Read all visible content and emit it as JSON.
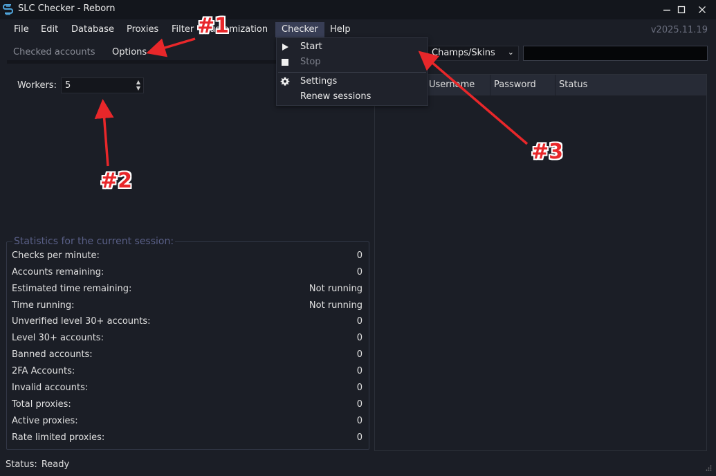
{
  "window": {
    "title": "SLC Checker - Reborn",
    "controls": {
      "minimize": "—",
      "maximize": "☐",
      "close": "✕"
    }
  },
  "menubar": {
    "items": [
      "File",
      "Edit",
      "Database",
      "Proxies",
      "Filter",
      "Customization",
      "Checker",
      "Help"
    ],
    "active": "Checker",
    "version": "v2025.11.19"
  },
  "tabs": {
    "checked_accounts": "Checked accounts",
    "options": "Options"
  },
  "workers": {
    "label": "Workers:",
    "value": "5"
  },
  "stats": {
    "title": "Statistics for the current session:",
    "rows": [
      {
        "label": "Checks per minute:",
        "value": "0"
      },
      {
        "label": "Accounts remaining:",
        "value": "0"
      },
      {
        "label": "Estimated time remaining:",
        "value": "Not running"
      },
      {
        "label": "Time running:",
        "value": "Not running"
      },
      {
        "label": "Unverified level 30+ accounts:",
        "value": "0"
      },
      {
        "label": "Level 30+ accounts:",
        "value": "0"
      },
      {
        "label": "Banned accounts:",
        "value": "0"
      },
      {
        "label": "2FA Accounts:",
        "value": "0"
      },
      {
        "label": "Invalid accounts:",
        "value": "0"
      },
      {
        "label": "Total proxies:",
        "value": "0"
      },
      {
        "label": "Active proxies:",
        "value": "0"
      },
      {
        "label": "Rate limited proxies:",
        "value": "0"
      }
    ]
  },
  "right_panel": {
    "combo_value": "Champs/Skins",
    "columns": [
      "Username",
      "Password",
      "Status"
    ]
  },
  "checker_menu": {
    "start": "Start",
    "stop": "Stop",
    "settings": "Settings",
    "renew_sessions": "Renew sessions"
  },
  "status": {
    "label": "Status:",
    "value": "Ready"
  },
  "annotations": {
    "a1": "#1",
    "a2": "#2",
    "a3": "#3",
    "color": "#e8272a"
  }
}
